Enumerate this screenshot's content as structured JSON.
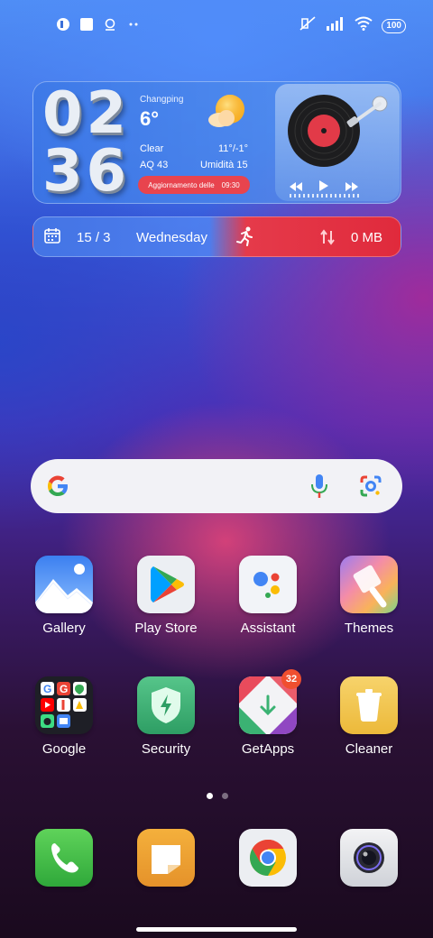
{
  "status": {
    "battery": "100"
  },
  "clock": {
    "hours": "02",
    "minutes": "36"
  },
  "weather": {
    "city": "Changping",
    "temp": "6°",
    "condition": "Clear",
    "range": "11°/-1°",
    "aq": "AQ 43",
    "humidity": "Umidità 15",
    "update_label": "Aggiornamento delle",
    "update_time": "09:30"
  },
  "date_widget": {
    "date": "15 / 3",
    "weekday": "Wednesday",
    "data_usage": "0 MB"
  },
  "apps_row1": [
    "Gallery",
    "Play Store",
    "Assistant",
    "Themes"
  ],
  "apps_row2": [
    "Google",
    "Security",
    "GetApps",
    "Cleaner"
  ],
  "getapps_badge": "32",
  "colors": {
    "date_red": "#e02a3c",
    "widget_blue": "#4f86e8"
  }
}
